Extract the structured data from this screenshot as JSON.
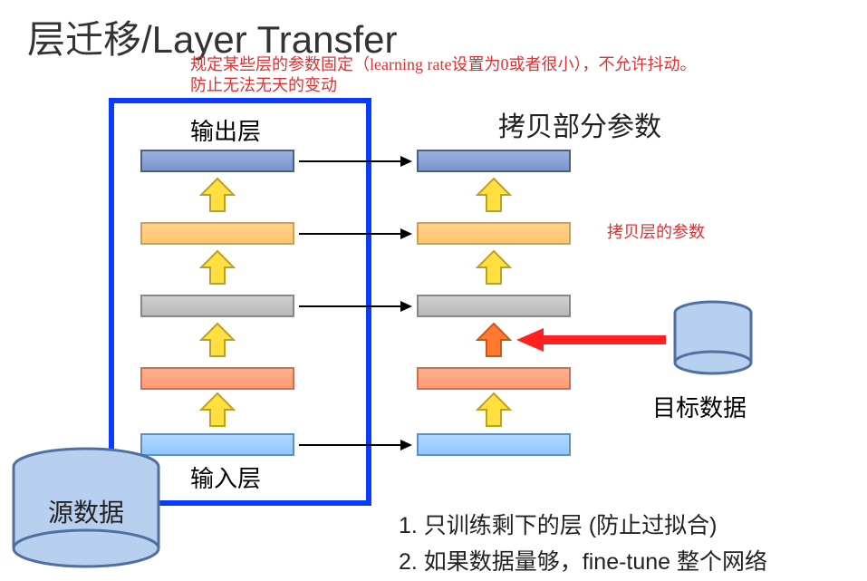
{
  "title": "层迁移/Layer Transfer",
  "notes": {
    "fixed_params": "规定某些层的参数固定（learning rate设置为0或者很小），不允许抖动。\n防止无法无天的变动",
    "copy_layer_params": "拷贝层的参数"
  },
  "labels": {
    "copy_partial_params": "拷贝部分参数",
    "output_layer": "输出层",
    "input_layer": "输入层",
    "source_data": "源数据",
    "target_data": "目标数据"
  },
  "bullets": {
    "b1": "1. 只训练剩下的层 (防止过拟合)",
    "b2": "2. 如果数据量够，fine-tune 整个网络"
  },
  "layers": {
    "left": [
      "output",
      "l2",
      "l3",
      "l4",
      "input"
    ],
    "right": [
      "output",
      "l2",
      "l3",
      "l4",
      "input"
    ]
  },
  "colors": {
    "output": "#8aa3d0",
    "l2": "#ffc980",
    "l3": "#c0c0c0",
    "l4": "#ff9f80",
    "input": "#a0d0ff",
    "box": "#0a3cff",
    "red_arrow": "#ff2020",
    "orange_arrow": "#ff7020",
    "yellow_arrow": "#ffe040"
  },
  "watermark": ""
}
